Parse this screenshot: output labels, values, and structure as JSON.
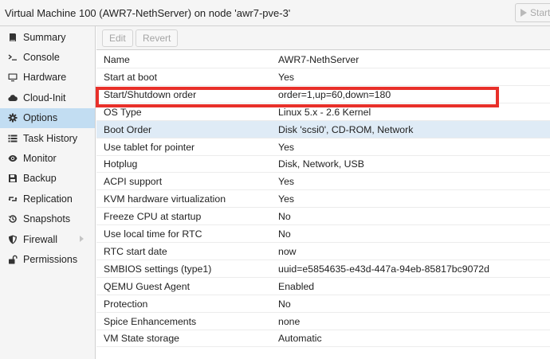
{
  "window": {
    "title": "Virtual Machine 100 (AWR7-NethServer) on node 'awr7-pve-3'",
    "start_label": "Start"
  },
  "sidebar": {
    "items": [
      {
        "label": "Summary",
        "icon": "book-icon"
      },
      {
        "label": "Console",
        "icon": "terminal-icon"
      },
      {
        "label": "Hardware",
        "icon": "monitor-icon"
      },
      {
        "label": "Cloud-Init",
        "icon": "cloud-icon"
      },
      {
        "label": "Options",
        "icon": "gear-icon",
        "selected": true
      },
      {
        "label": "Task History",
        "icon": "list-icon"
      },
      {
        "label": "Monitor",
        "icon": "eye-icon"
      },
      {
        "label": "Backup",
        "icon": "floppy-icon"
      },
      {
        "label": "Replication",
        "icon": "retweet-icon"
      },
      {
        "label": "Snapshots",
        "icon": "history-icon"
      },
      {
        "label": "Firewall",
        "icon": "shield-icon",
        "expandable": true
      },
      {
        "label": "Permissions",
        "icon": "unlock-icon"
      }
    ]
  },
  "toolbar": {
    "edit_label": "Edit",
    "revert_label": "Revert"
  },
  "options": {
    "rows": [
      {
        "name": "Name",
        "value": "AWR7-NethServer"
      },
      {
        "name": "Start at boot",
        "value": "Yes"
      },
      {
        "name": "Start/Shutdown order",
        "value": "order=1,up=60,down=180"
      },
      {
        "name": "OS Type",
        "value": "Linux 5.x - 2.6 Kernel"
      },
      {
        "name": "Boot Order",
        "value": "Disk 'scsi0', CD-ROM, Network",
        "selected": true
      },
      {
        "name": "Use tablet for pointer",
        "value": "Yes"
      },
      {
        "name": "Hotplug",
        "value": "Disk, Network, USB"
      },
      {
        "name": "ACPI support",
        "value": "Yes"
      },
      {
        "name": "KVM hardware virtualization",
        "value": "Yes"
      },
      {
        "name": "Freeze CPU at startup",
        "value": "No"
      },
      {
        "name": "Use local time for RTC",
        "value": "No"
      },
      {
        "name": "RTC start date",
        "value": "now"
      },
      {
        "name": "SMBIOS settings (type1)",
        "value": "uuid=e5854635-e43d-447a-94eb-85817bc9072d"
      },
      {
        "name": "QEMU Guest Agent",
        "value": "Enabled"
      },
      {
        "name": "Protection",
        "value": "No"
      },
      {
        "name": "Spice Enhancements",
        "value": "none"
      },
      {
        "name": "VM State storage",
        "value": "Automatic"
      }
    ]
  },
  "colors": {
    "selection": "#c2ddf2",
    "row_selection": "#dfebf6",
    "highlight": "#e8302a"
  }
}
